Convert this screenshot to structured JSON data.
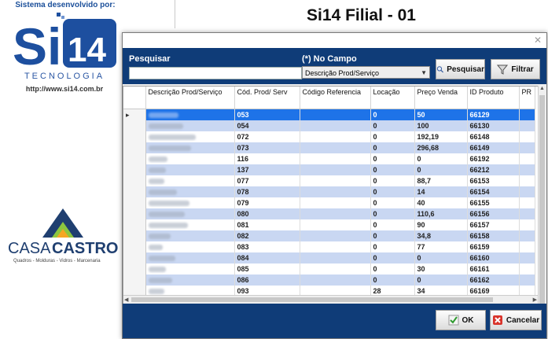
{
  "background": {
    "sistema_label": "Sistema desenvolvido por:",
    "logo_text": "Si14",
    "logo_tecnologia": "TECNOLOGIA",
    "logo_url": "http://www.si14.com.br",
    "company_logo_name": "CASACASTRO",
    "company_logo_sub": "Quadros - Molduras - Vidros - Marcenaria",
    "app_title": "Si14 Filial - 01"
  },
  "dialog": {
    "close_glyph": "✕",
    "search_label": "Pesquisar",
    "search_value": "",
    "field_label": "(*) No Campo",
    "field_value": "Descrição Prod/Serviço",
    "search_button": "Pesquisar",
    "filter_button": "Filtrar",
    "ok_button": "OK",
    "cancel_button": "Cancelar",
    "icons": {
      "search": "magnifier-icon",
      "filter": "funnel-icon",
      "ok": "check-icon",
      "cancel": "x-icon"
    }
  },
  "grid": {
    "columns": [
      "Descrição Prod/Serviço",
      "Cód. Prod/ Serv",
      "Código Referencia",
      "Locação",
      "Preço Venda",
      "ID Produto",
      "PR"
    ],
    "rows": [
      {
        "desc": "",
        "cod": "053",
        "ref": "",
        "loc": "0",
        "preco": "50",
        "id": "66129"
      },
      {
        "desc": "",
        "cod": "054",
        "ref": "",
        "loc": "0",
        "preco": "100",
        "id": "66130"
      },
      {
        "desc": "",
        "cod": "072",
        "ref": "",
        "loc": "0",
        "preco": "192,19",
        "id": "66148"
      },
      {
        "desc": "",
        "cod": "073",
        "ref": "",
        "loc": "0",
        "preco": "296,68",
        "id": "66149"
      },
      {
        "desc": "",
        "cod": "116",
        "ref": "",
        "loc": "0",
        "preco": "0",
        "id": "66192"
      },
      {
        "desc": "",
        "cod": "137",
        "ref": "",
        "loc": "0",
        "preco": "0",
        "id": "66212"
      },
      {
        "desc": "",
        "cod": "077",
        "ref": "",
        "loc": "0",
        "preco": "88,7",
        "id": "66153"
      },
      {
        "desc": "",
        "cod": "078",
        "ref": "",
        "loc": "0",
        "preco": "14",
        "id": "66154"
      },
      {
        "desc": "",
        "cod": "079",
        "ref": "",
        "loc": "0",
        "preco": "40",
        "id": "66155"
      },
      {
        "desc": "",
        "cod": "080",
        "ref": "",
        "loc": "0",
        "preco": "110,6",
        "id": "66156"
      },
      {
        "desc": "",
        "cod": "081",
        "ref": "",
        "loc": "0",
        "preco": "90",
        "id": "66157"
      },
      {
        "desc": "",
        "cod": "082",
        "ref": "",
        "loc": "0",
        "preco": "34,8",
        "id": "66158"
      },
      {
        "desc": "",
        "cod": "083",
        "ref": "",
        "loc": "0",
        "preco": "77",
        "id": "66159"
      },
      {
        "desc": "",
        "cod": "084",
        "ref": "",
        "loc": "0",
        "preco": "0",
        "id": "66160"
      },
      {
        "desc": "",
        "cod": "085",
        "ref": "",
        "loc": "0",
        "preco": "30",
        "id": "66161"
      },
      {
        "desc": "",
        "cod": "086",
        "ref": "",
        "loc": "0",
        "preco": "0",
        "id": "66162"
      },
      {
        "desc": "",
        "cod": "093",
        "ref": "",
        "loc": "28",
        "preco": "34",
        "id": "66169"
      }
    ]
  }
}
